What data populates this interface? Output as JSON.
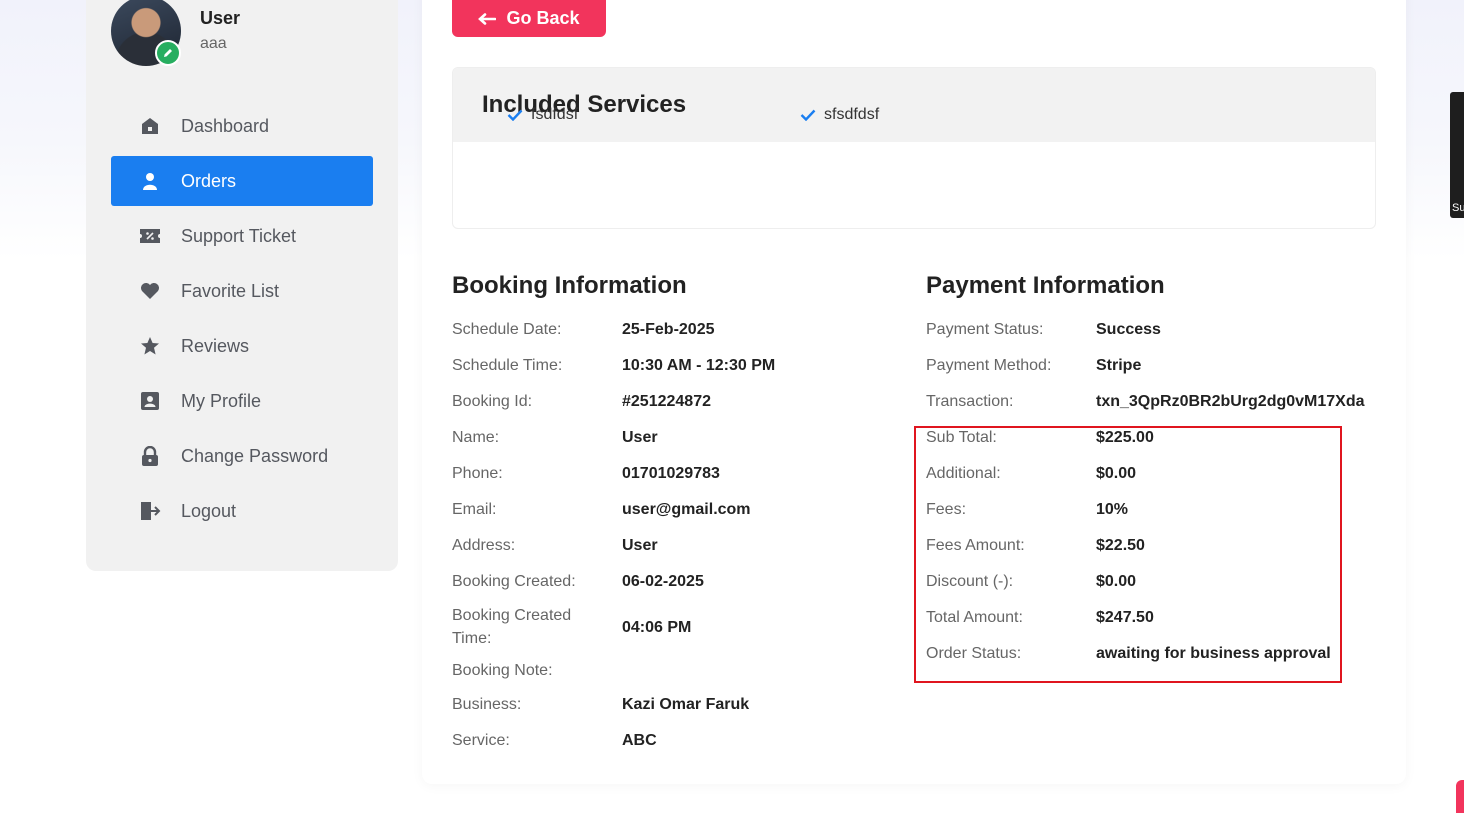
{
  "profile": {
    "name": "User",
    "subtitle": "aaa"
  },
  "menu": [
    {
      "label": "Dashboard",
      "icon": "home-icon",
      "active": false
    },
    {
      "label": "Orders",
      "icon": "user-icon",
      "active": true
    },
    {
      "label": "Support Ticket",
      "icon": "ticket-icon",
      "active": false
    },
    {
      "label": "Favorite List",
      "icon": "heart-icon",
      "active": false
    },
    {
      "label": "Reviews",
      "icon": "star-icon",
      "active": false
    },
    {
      "label": "My Profile",
      "icon": "id-card-icon",
      "active": false
    },
    {
      "label": "Change Password",
      "icon": "lock-icon",
      "active": false
    },
    {
      "label": "Logout",
      "icon": "logout-icon",
      "active": false
    }
  ],
  "go_back": "Go Back",
  "services": {
    "title": "Included Services",
    "items": [
      "fsdfdsf",
      "sfsdfdsf"
    ]
  },
  "booking": {
    "title": "Booking Information",
    "rows": [
      {
        "label": "Schedule Date:",
        "value": "25-Feb-2025"
      },
      {
        "label": "Schedule Time:",
        "value": "10:30 AM - 12:30 PM"
      },
      {
        "label": "Booking Id:",
        "value": "#251224872"
      },
      {
        "label": "Name:",
        "value": "User"
      },
      {
        "label": "Phone:",
        "value": "01701029783"
      },
      {
        "label": "Email:",
        "value": "user@gmail.com"
      },
      {
        "label": "Address:",
        "value": "User"
      },
      {
        "label": "Booking Created:",
        "value": "06-02-2025"
      },
      {
        "label": "Booking Created Time:",
        "value": "04:06 PM"
      },
      {
        "label": "Booking Note:",
        "value": ""
      },
      {
        "label": "Business:",
        "value": "Kazi Omar Faruk"
      },
      {
        "label": "Service:",
        "value": "ABC"
      }
    ]
  },
  "payment": {
    "title": "Payment Information",
    "rows": [
      {
        "label": "Payment Status:",
        "value": "Success"
      },
      {
        "label": "Payment Method:",
        "value": "Stripe"
      },
      {
        "label": "Transaction:",
        "value": "txn_3QpRz0BR2bUrg2dg0vM17Xda"
      },
      {
        "label": "Sub Total:",
        "value": "$225.00"
      },
      {
        "label": "Additional:",
        "value": "$0.00"
      },
      {
        "label": "Fees:",
        "value": "10%"
      },
      {
        "label": "Fees Amount:",
        "value": "$22.50"
      },
      {
        "label": "Discount (-):",
        "value": "$0.00"
      },
      {
        "label": "Total Amount:",
        "value": "$247.50"
      },
      {
        "label": "Order Status:",
        "value": "awaiting for business approval"
      }
    ]
  },
  "edge_tab_text": "Su",
  "colors": {
    "accent_blue": "#1a7ef0",
    "go_back_red": "#f2345c",
    "highlight_red": "#e0151f"
  }
}
